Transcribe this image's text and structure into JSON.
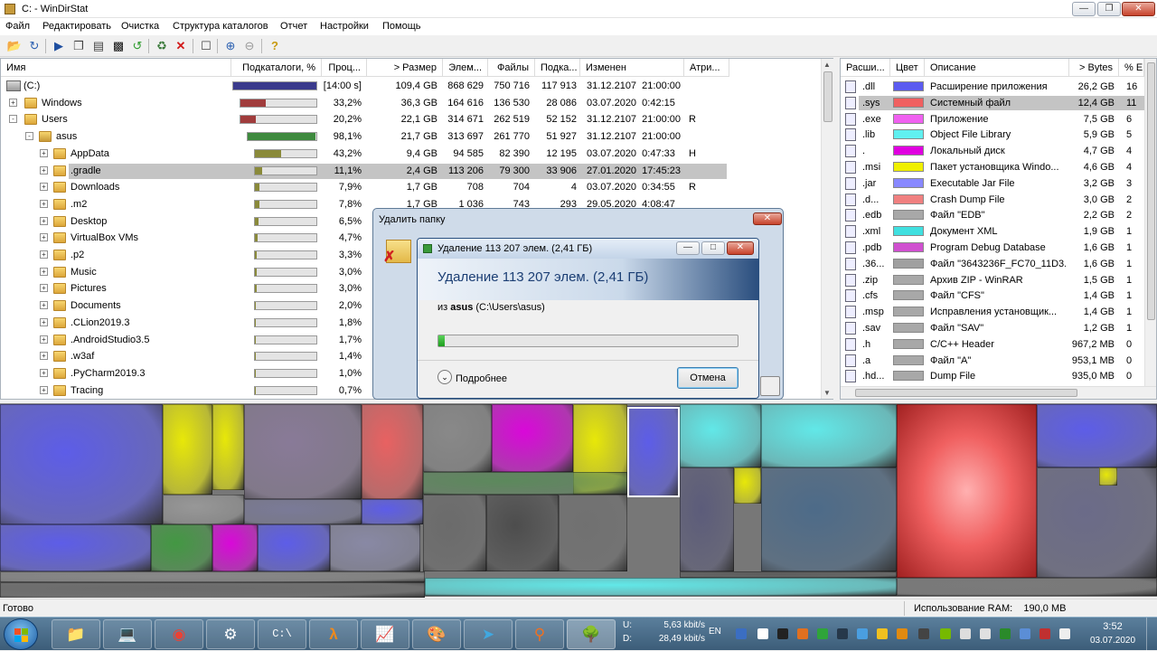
{
  "window": {
    "title": "C: - WinDirStat",
    "min_label": "0",
    "max_label": "1",
    "close_label": "r"
  },
  "menu": [
    "Файл",
    "Редактировать",
    "Очистка",
    "Структура каталогов",
    "Отчет",
    "Настройки",
    "Помощь"
  ],
  "tree": {
    "headers": [
      "Имя",
      "Подкаталоги, %",
      "Проц...",
      "> Размер",
      "Элем...",
      "Файлы",
      "Подка...",
      "Изменен",
      "Атри..."
    ],
    "rows": [
      {
        "name": "(C:)",
        "pct_text": "[14:00 s]",
        "pct": 1.0,
        "bar_color": "#3a3a8c",
        "size": "109,4 GB",
        "items": "868 629",
        "files": "750 716",
        "subdirs": "117 913",
        "modified": "31.12.2107  21:00:00",
        "attr": "",
        "level": 0,
        "expander": "",
        "icon": "drive"
      },
      {
        "name": "Windows",
        "pct_text": "33,2%",
        "pct": 0.332,
        "bar_color": "#a03c3c",
        "size": "36,3 GB",
        "items": "164 616",
        "files": "136 530",
        "subdirs": "28 086",
        "modified": "03.07.2020  0:42:15",
        "attr": "",
        "level": 1,
        "expander": "+",
        "icon": "folder"
      },
      {
        "name": "Users",
        "pct_text": "20,2%",
        "pct": 0.202,
        "bar_color": "#a03c3c",
        "size": "22,1 GB",
        "items": "314 671",
        "files": "262 519",
        "subdirs": "52 152",
        "modified": "31.12.2107  21:00:00",
        "attr": "R",
        "level": 1,
        "expander": "-",
        "icon": "folder"
      },
      {
        "name": "asus",
        "pct_text": "98,1%",
        "pct": 0.981,
        "bar_color": "#3e8a3e",
        "size": "21,7 GB",
        "items": "313 697",
        "files": "261 770",
        "subdirs": "51 927",
        "modified": "31.12.2107  21:00:00",
        "attr": "",
        "level": 2,
        "expander": "-",
        "icon": "userfolder"
      },
      {
        "name": "AppData",
        "pct_text": "43,2%",
        "pct": 0.432,
        "bar_color": "#8a8a3a",
        "size": "9,4 GB",
        "items": "94 585",
        "files": "82 390",
        "subdirs": "12 195",
        "modified": "03.07.2020  0:47:33",
        "attr": "H",
        "level": 3,
        "expander": "+",
        "icon": "folder"
      },
      {
        "name": ".gradle",
        "pct_text": "11,1%",
        "pct": 0.111,
        "bar_color": "#8a8a3a",
        "size": "2,4 GB",
        "items": "113 206",
        "files": "79 300",
        "subdirs": "33 906",
        "modified": "27.01.2020  17:45:23",
        "attr": "",
        "level": 3,
        "expander": "+",
        "icon": "folder",
        "selected": true
      },
      {
        "name": "Downloads",
        "pct_text": "7,9%",
        "pct": 0.079,
        "bar_color": "#8a8a3a",
        "size": "1,7 GB",
        "items": "708",
        "files": "704",
        "subdirs": "4",
        "modified": "03.07.2020  0:34:55",
        "attr": "R",
        "level": 3,
        "expander": "+",
        "icon": "folder"
      },
      {
        "name": ".m2",
        "pct_text": "7,8%",
        "pct": 0.078,
        "bar_color": "#8a8a3a",
        "size": "1,7 GB",
        "items": "1 036",
        "files": "743",
        "subdirs": "293",
        "modified": "29.05.2020  4:08:47",
        "attr": "",
        "level": 3,
        "expander": "+",
        "icon": "folder"
      },
      {
        "name": "Desktop",
        "pct_text": "6,5%",
        "pct": 0.065,
        "bar_color": "#8a8a3a",
        "size": "",
        "items": "",
        "files": "",
        "subdirs": "",
        "modified": "",
        "attr": "",
        "level": 3,
        "expander": "+",
        "icon": "folder"
      },
      {
        "name": "VirtualBox VMs",
        "pct_text": "4,7%",
        "pct": 0.047,
        "bar_color": "#8a8a3a",
        "size": "",
        "items": "",
        "files": "",
        "subdirs": "",
        "modified": "",
        "attr": "",
        "level": 3,
        "expander": "+",
        "icon": "folder"
      },
      {
        "name": ".p2",
        "pct_text": "3,3%",
        "pct": 0.033,
        "bar_color": "#8a8a3a",
        "size": "",
        "items": "",
        "files": "",
        "subdirs": "",
        "modified": "",
        "attr": "",
        "level": 3,
        "expander": "+",
        "icon": "folder"
      },
      {
        "name": "Music",
        "pct_text": "3,0%",
        "pct": 0.03,
        "bar_color": "#8a8a3a",
        "size": "",
        "items": "",
        "files": "",
        "subdirs": "",
        "modified": "",
        "attr": "",
        "level": 3,
        "expander": "+",
        "icon": "folder"
      },
      {
        "name": "Pictures",
        "pct_text": "3,0%",
        "pct": 0.03,
        "bar_color": "#8a8a3a",
        "size": "",
        "items": "",
        "files": "",
        "subdirs": "",
        "modified": "",
        "attr": "",
        "level": 3,
        "expander": "+",
        "icon": "folder"
      },
      {
        "name": "Documents",
        "pct_text": "2,0%",
        "pct": 0.02,
        "bar_color": "#8a8a3a",
        "size": "",
        "items": "",
        "files": "",
        "subdirs": "",
        "modified": "",
        "attr": "",
        "level": 3,
        "expander": "+",
        "icon": "folder"
      },
      {
        "name": ".CLion2019.3",
        "pct_text": "1,8%",
        "pct": 0.018,
        "bar_color": "#8a8a3a",
        "size": "",
        "items": "",
        "files": "",
        "subdirs": "",
        "modified": "",
        "attr": "",
        "level": 3,
        "expander": "+",
        "icon": "folder"
      },
      {
        "name": ".AndroidStudio3.5",
        "pct_text": "1,7%",
        "pct": 0.017,
        "bar_color": "#8a8a3a",
        "size": "",
        "items": "",
        "files": "",
        "subdirs": "",
        "modified": "",
        "attr": "",
        "level": 3,
        "expander": "+",
        "icon": "folder"
      },
      {
        "name": ".w3af",
        "pct_text": "1,4%",
        "pct": 0.014,
        "bar_color": "#8a8a3a",
        "size": "",
        "items": "",
        "files": "",
        "subdirs": "",
        "modified": "",
        "attr": "",
        "level": 3,
        "expander": "+",
        "icon": "folder"
      },
      {
        "name": ".PyCharm2019.3",
        "pct_text": "1,0%",
        "pct": 0.01,
        "bar_color": "#8a8a3a",
        "size": "",
        "items": "",
        "files": "",
        "subdirs": "",
        "modified": "",
        "attr": "",
        "level": 3,
        "expander": "+",
        "icon": "folder"
      },
      {
        "name": "Tracing",
        "pct_text": "0,7%",
        "pct": 0.007,
        "bar_color": "#8a8a3a",
        "size": "",
        "items": "",
        "files": "",
        "subdirs": "",
        "modified": "",
        "attr": "",
        "level": 3,
        "expander": "+",
        "icon": "folder"
      }
    ]
  },
  "extensions": {
    "headers": [
      "Расши...",
      "Цвет",
      "Описание",
      "> Bytes",
      "% E"
    ],
    "rows": [
      {
        "ext": ".dll",
        "color": "#5b5bf0",
        "desc": "Расширение приложения",
        "bytes": "26,2 GB",
        "pct": "16"
      },
      {
        "ext": ".sys",
        "color": "#f06060",
        "desc": "Системный файл",
        "bytes": "12,4 GB",
        "pct": "11",
        "selected": true
      },
      {
        "ext": ".exe",
        "color": "#f060f0",
        "desc": "Приложение",
        "bytes": "7,5 GB",
        "pct": "6"
      },
      {
        "ext": ".lib",
        "color": "#60f0f0",
        "desc": "Object File Library",
        "bytes": "5,9 GB",
        "pct": "5"
      },
      {
        "ext": ".",
        "color": "#e000e0",
        "desc": "Локальный диск",
        "bytes": "4,7 GB",
        "pct": "4"
      },
      {
        "ext": ".msi",
        "color": "#f0f000",
        "desc": "Пакет установщика Windo...",
        "bytes": "4,6 GB",
        "pct": "4"
      },
      {
        "ext": ".jar",
        "color": "#8888ff",
        "desc": "Executable Jar File",
        "bytes": "3,2 GB",
        "pct": "3"
      },
      {
        "ext": ".d...",
        "color": "#f08080",
        "desc": "Crash Dump File",
        "bytes": "3,0 GB",
        "pct": "2"
      },
      {
        "ext": ".edb",
        "color": "#a8a8a8",
        "desc": "Файл \"EDB\"",
        "bytes": "2,2 GB",
        "pct": "2"
      },
      {
        "ext": ".xml",
        "color": "#40e0e0",
        "desc": "Документ XML",
        "bytes": "1,9 GB",
        "pct": "1"
      },
      {
        "ext": ".pdb",
        "color": "#d050d0",
        "desc": "Program Debug Database",
        "bytes": "1,6 GB",
        "pct": "1"
      },
      {
        "ext": ".36...",
        "color": "#a0a0a0",
        "desc": "Файл \"3643236F_FC70_11D3...",
        "bytes": "1,6 GB",
        "pct": "1"
      },
      {
        "ext": ".zip",
        "color": "#a8a8a8",
        "desc": "Архив ZIP - WinRAR",
        "bytes": "1,5 GB",
        "pct": "1"
      },
      {
        "ext": ".cfs",
        "color": "#a8a8a8",
        "desc": "Файл \"CFS\"",
        "bytes": "1,4 GB",
        "pct": "1"
      },
      {
        "ext": ".msp",
        "color": "#a8a8a8",
        "desc": "Исправления установщик...",
        "bytes": "1,4 GB",
        "pct": "1"
      },
      {
        "ext": ".sav",
        "color": "#a8a8a8",
        "desc": "Файл \"SAV\"",
        "bytes": "1,2 GB",
        "pct": "1"
      },
      {
        "ext": ".h",
        "color": "#a8a8a8",
        "desc": "C/C++ Header",
        "bytes": "967,2 MB",
        "pct": "0"
      },
      {
        "ext": ".a",
        "color": "#a8a8a8",
        "desc": "Файл \"A\"",
        "bytes": "953,1 MB",
        "pct": "0"
      },
      {
        "ext": ".hd...",
        "color": "#a8a8a8",
        "desc": "Dump File",
        "bytes": "935,0 MB",
        "pct": "0"
      }
    ]
  },
  "dialog_outer": {
    "title": "Удалить папку",
    "close_label": "x"
  },
  "dialog_inner": {
    "title": "Удаление 113 207 элем. (2,41 ГБ)",
    "heading": "Удаление 113 207 элем. (2,41 ГБ)",
    "from_prefix": "из ",
    "from_bold": "asus",
    "from_path": " (C:\\Users\\asus)",
    "progress": 0.02,
    "details_label": "Подробнее",
    "cancel_label": "Отмена"
  },
  "status": {
    "left": "Готово",
    "ram": "Использование RAM:    190,0 MB"
  },
  "taskbar": {
    "net_up_label": "U:",
    "net_up": "5,63 kbit/s",
    "net_down_label": "D:",
    "net_down": "28,49 kbit/s",
    "lang": "EN",
    "time": "3:52",
    "date": "03.07.2020"
  },
  "colors": {
    "dll": "#5b5bf0",
    "sys": "#f06060",
    "exe": "#f060f0",
    "lib": "#60f0f0",
    "local": "#e000e0",
    "msi": "#f0f000",
    "gray": "#a8a8a8"
  }
}
